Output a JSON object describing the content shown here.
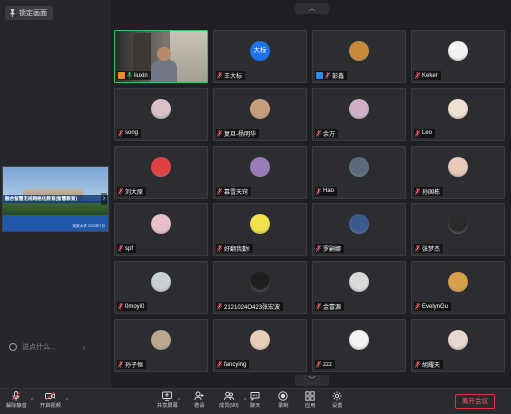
{
  "left_panel": {
    "lock_label": "锁定画面",
    "share_title": "融合智慧无线网络化教育(智慧教育)",
    "share_subtitle": "某某大学 2020年7月",
    "chat_placeholder": "说点什么..."
  },
  "participants": [
    {
      "name": "liuxin",
      "avatar": "video",
      "active": true,
      "badge": "host-orange",
      "mic": "green"
    },
    {
      "name": "王大标",
      "avatar": "text",
      "avatar_text": "大标",
      "avatar_color": "#1a73e8",
      "mic": "red"
    },
    {
      "name": "彭鑫",
      "avatar": "photo",
      "avatar_color": "#c98a3c",
      "badge": "cohost-blue",
      "mic": "red"
    },
    {
      "name": "Keker",
      "avatar": "photo",
      "avatar_color": "#f2f2f2",
      "mic": "red"
    },
    {
      "name": "song",
      "avatar": "photo",
      "avatar_color": "#d7c2c8",
      "mic": "red"
    },
    {
      "name": "复旦-杨明华",
      "avatar": "photo",
      "avatar_color": "#c89d7a",
      "mic": "red"
    },
    {
      "name": "余万",
      "avatar": "photo",
      "avatar_color": "#d0b0c8",
      "mic": "red"
    },
    {
      "name": "Leo",
      "avatar": "photo",
      "avatar_color": "#f0e0d0",
      "mic": "red"
    },
    {
      "name": "刘大原",
      "avatar": "photo",
      "avatar_color": "#e04040",
      "mic": "red"
    },
    {
      "name": "慕雪天窍",
      "avatar": "photo",
      "avatar_color": "#9a7ab8",
      "mic": "red"
    },
    {
      "name": "Hao",
      "avatar": "photo",
      "avatar_color": "#5a6a7a",
      "mic": "red"
    },
    {
      "name": "孙国栋",
      "avatar": "photo",
      "avatar_color": "#e8c8b8",
      "mic": "red"
    },
    {
      "name": "spf",
      "avatar": "photo",
      "avatar_color": "#e8c0c8",
      "mic": "red"
    },
    {
      "name": "好翻我勤!",
      "avatar": "photo",
      "avatar_color": "#f4e04a",
      "mic": "red"
    },
    {
      "name": "罗嗣娜",
      "avatar": "photo",
      "avatar_color": "#3a5a90",
      "mic": "red"
    },
    {
      "name": "张梦杰",
      "avatar": "photo",
      "avatar_color": "#2a2a2a",
      "mic": "red"
    },
    {
      "name": "0moyi0",
      "avatar": "photo",
      "avatar_color": "#c8d0d8",
      "mic": "red"
    },
    {
      "name": "2121024O423张宏波",
      "avatar": "photo",
      "avatar_color": "#1e1e1e",
      "mic": "red"
    },
    {
      "name": "金富源",
      "avatar": "photo",
      "avatar_color": "#dadada",
      "mic": "red"
    },
    {
      "name": "EvelynGu",
      "avatar": "photo",
      "avatar_color": "#d8a048",
      "mic": "red"
    },
    {
      "name": "孙子恒",
      "avatar": "photo",
      "avatar_color": "#b8a890",
      "mic": "red"
    },
    {
      "name": "fancying",
      "avatar": "photo",
      "avatar_color": "#e8d0b8",
      "mic": "red"
    },
    {
      "name": "zzz",
      "avatar": "photo",
      "avatar_color": "#f4f4f4",
      "mic": "red"
    },
    {
      "name": "胡耀天",
      "avatar": "photo",
      "avatar_color": "#e8d8d0",
      "mic": "red"
    }
  ],
  "toolbar": {
    "mute_label": "解除静音",
    "video_label": "开启视频",
    "share_label": "共享屏幕",
    "invite_label": "邀请",
    "members_label": "成员(90)",
    "chat_label": "聊天",
    "record_label": "录制",
    "apps_label": "应用",
    "settings_label": "设置",
    "end_label": "离开会议"
  },
  "colors": {
    "accent_green": "#3cc05a",
    "danger": "#e0343d"
  }
}
